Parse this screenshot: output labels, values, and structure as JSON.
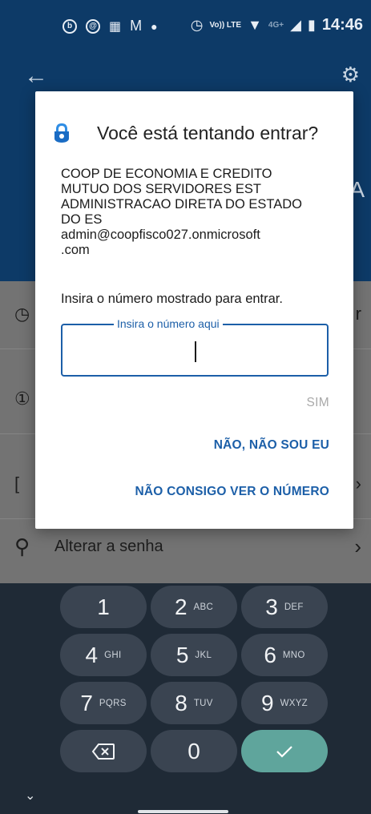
{
  "status_bar": {
    "time": "14:46",
    "left_icons": [
      "b-circle-icon",
      "at-icon",
      "news-icon",
      "gmail-icon",
      "dot-icon"
    ],
    "right_icons": [
      "alarm-icon",
      "volte-icon",
      "wifi-icon",
      "signal-4g-icon",
      "battery-icon"
    ],
    "network_label": "4G+",
    "volte_label": "Vo)) LTE"
  },
  "app_bar": {
    "partial_letter": "A"
  },
  "list": {
    "rows": [
      {
        "lead": "◷",
        "trail": "r"
      },
      {
        "lead": "①",
        "trail": ""
      },
      {
        "lead": "[",
        "trail": "›"
      }
    ],
    "change_password_label": "Alterar a senha"
  },
  "dialog": {
    "title": "Você está tentando entrar?",
    "org_lines": [
      "COOP DE ECONOMIA E CREDITO",
      "MUTUO DOS SERVIDORES EST",
      "ADMINISTRACAO DIRETA DO ESTADO",
      "DO ES",
      "admin@coopfisco027.onmicrosoft",
      ".com"
    ],
    "instruction": "Insira o número mostrado para entrar.",
    "input_label": "Insira o número aqui",
    "input_value": "",
    "btn_yes": "SIM",
    "btn_not_me": "NÃO, NÃO SOU EU",
    "btn_cant_see": "NÃO CONSIGO VER O NÚMERO",
    "accent_color": "#1c5fa8"
  },
  "keyboard": {
    "keys": [
      {
        "main": "1",
        "sub": ""
      },
      {
        "main": "2",
        "sub": "ABC"
      },
      {
        "main": "3",
        "sub": "DEF"
      },
      {
        "main": "4",
        "sub": "GHI"
      },
      {
        "main": "5",
        "sub": "JKL"
      },
      {
        "main": "6",
        "sub": "MNO"
      },
      {
        "main": "7",
        "sub": "PQRS"
      },
      {
        "main": "8",
        "sub": "TUV"
      },
      {
        "main": "9",
        "sub": "WXYZ"
      },
      {
        "main": "0",
        "sub": ""
      }
    ],
    "backspace_icon": "backspace-icon",
    "enter_icon": "check-icon",
    "enter_color": "#5fa59c"
  }
}
